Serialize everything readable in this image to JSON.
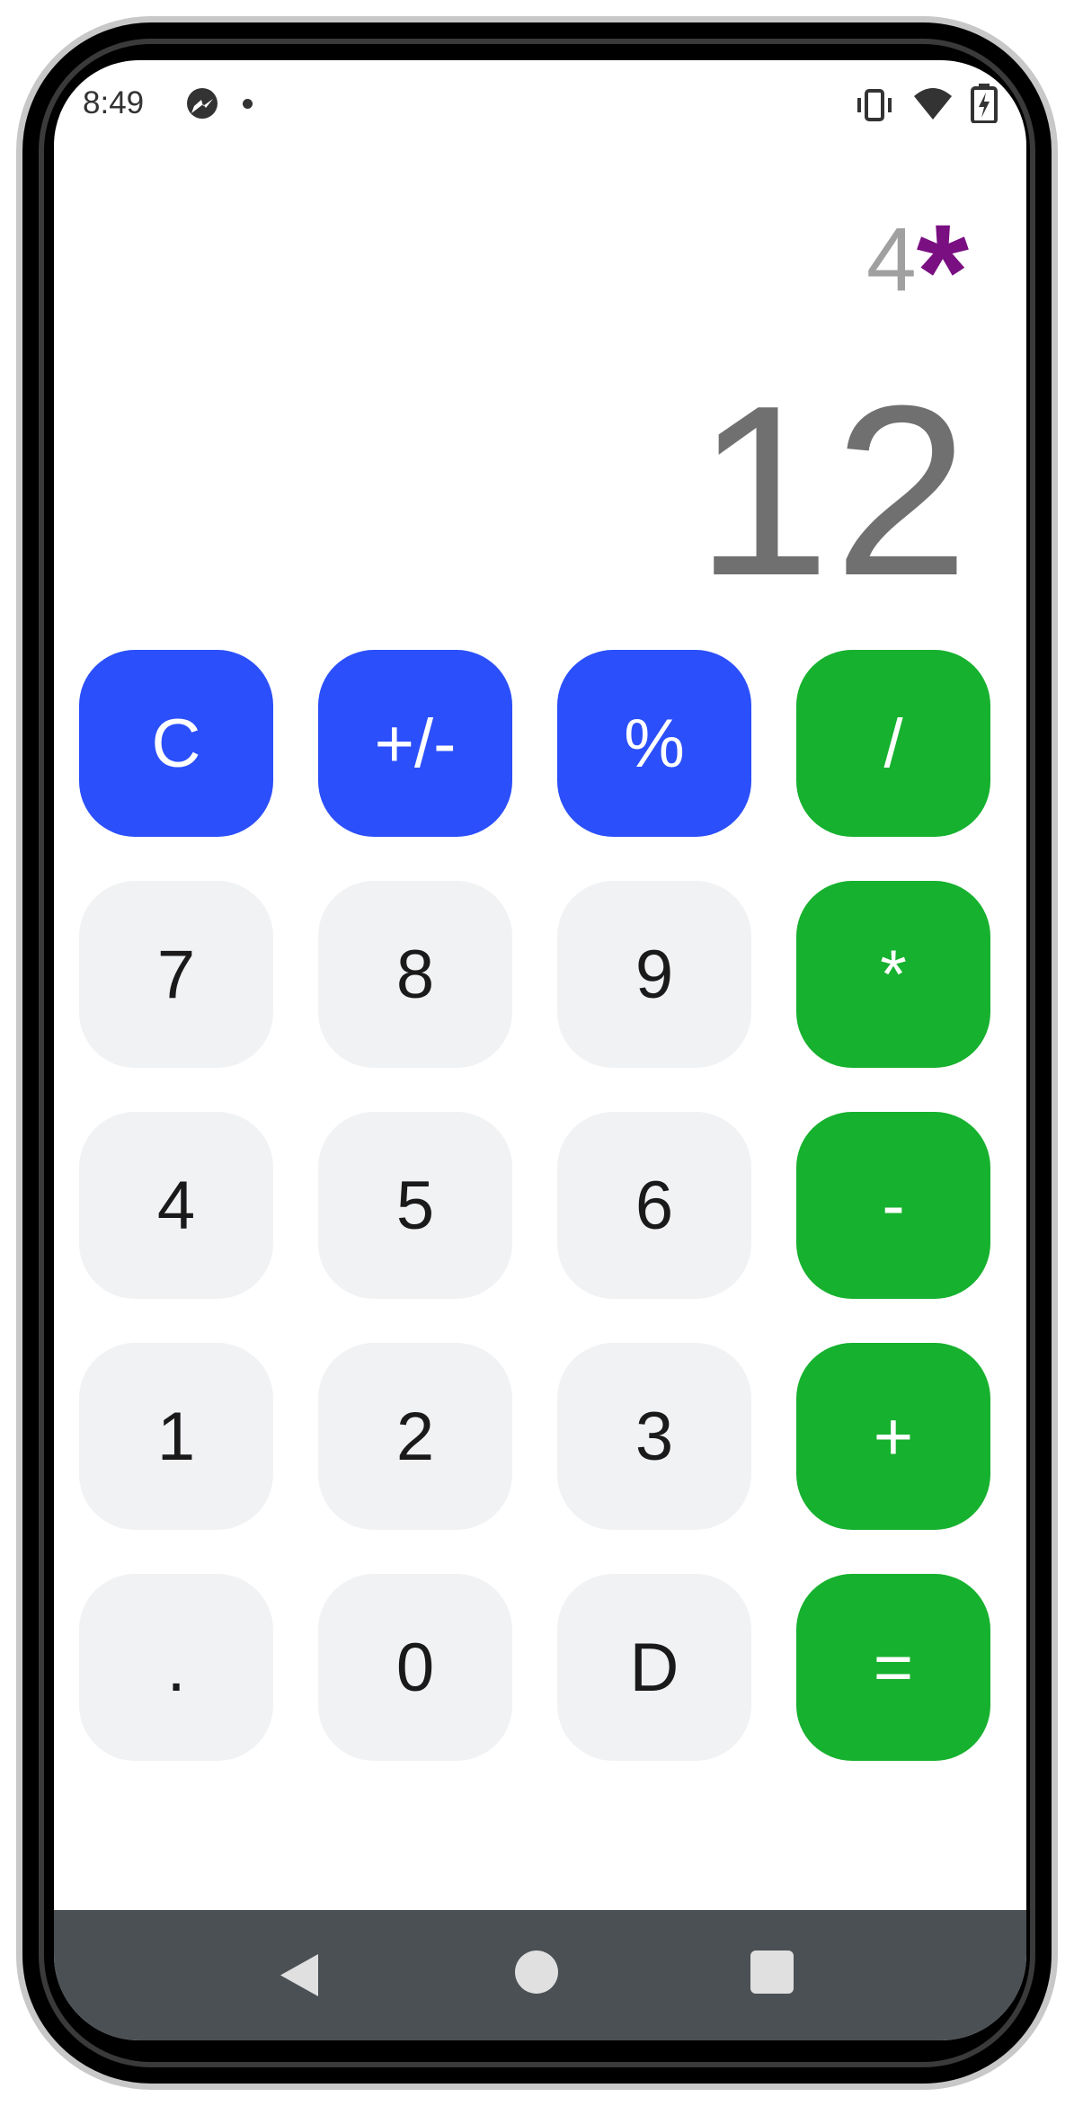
{
  "status_bar": {
    "time": "8:49",
    "icons": [
      "messenger-icon",
      "dot-icon",
      "vibrate-icon",
      "wifi-icon",
      "battery-charging-icon"
    ]
  },
  "display": {
    "expression_number": "4",
    "expression_operator": "*",
    "result": "12"
  },
  "keypad": {
    "row1": [
      "C",
      "+/-",
      "%",
      "/"
    ],
    "row2": [
      "7",
      "8",
      "9",
      "*"
    ],
    "row3": [
      "4",
      "5",
      "6",
      "-"
    ],
    "row4": [
      "1",
      "2",
      "3",
      "+"
    ],
    "row5": [
      ".",
      "0",
      "D",
      "="
    ]
  },
  "colors": {
    "function_key": "#2b4ffa",
    "operator_key": "#16b12e",
    "digit_key": "#f1f2f4",
    "operator_accent": "#7a0f82",
    "nav_bar": "#4a5054"
  },
  "nav_bar": {
    "icons": [
      "back-icon",
      "home-icon",
      "recents-icon"
    ]
  }
}
